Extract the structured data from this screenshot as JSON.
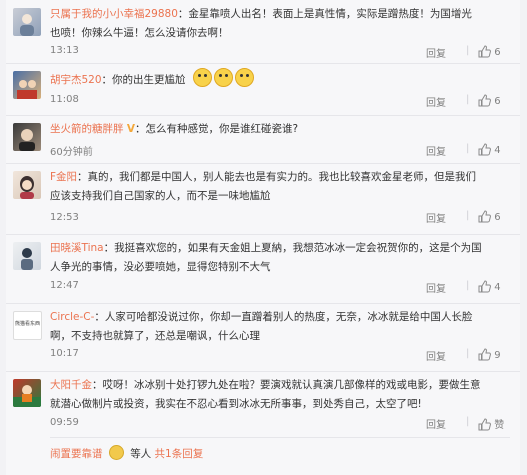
{
  "comments": [
    {
      "username": "只属于我的小小幸福29880",
      "text": "：金星靠喷人出名！表面上是真性情，实际是蹭热度！为国增光也喷！你辣么牛逼！怎么没请你去啊！",
      "time": "13:13",
      "reply_label": "回复",
      "likes": "6",
      "avatar_colors": [
        "#c9cdd6",
        "#8fa0b8"
      ]
    },
    {
      "username": "胡宇杰520",
      "text": "：你的出生更尴尬",
      "emojis": [
        "awkward-emoji-icon",
        "awkward-emoji-icon",
        "awkward-emoji-icon"
      ],
      "time": "11:08",
      "reply_label": "回复",
      "likes": "6",
      "avatar_colors": [
        "#4a6fa5",
        "#d9b07a"
      ]
    },
    {
      "username": "坐火箭的糖胖胖",
      "verified": "V",
      "text": "：怎么有种感觉，你是谁红碰瓷谁?",
      "time": "60分钟前",
      "reply_label": "回复",
      "likes": "4",
      "avatar_colors": [
        "#3a3a3a",
        "#9c8b7a"
      ]
    },
    {
      "username": "F金阳",
      "text": "：真的，我们都是中国人，别人能去也是有实力的。我也比较喜欢金星老师，但是我们应该支持我们自己国家的人，而不是一味地尴尬",
      "time": "12:53",
      "reply_label": "回复",
      "likes": "6",
      "avatar_colors": [
        "#f1e6dc",
        "#3b2f2f"
      ]
    },
    {
      "username": "田晓溪Tina",
      "text": "：我挺喜欢您的，如果有天金姐上夏納，我想范冰冰一定会祝贺你的，这是个为国人争光的事情，没必要喷她，显得您特别不大气",
      "time": "12:47",
      "reply_label": "回复",
      "likes": "4",
      "avatar_colors": [
        "#eef0f2",
        "#2d3a4a"
      ]
    },
    {
      "username": "Circle-C-",
      "text": "：人家可哈都没说过你，你却一直蹭着别人的热度，无奈，冰冰就是给中国人长脸啊，不支持也就算了，还总是嘲讽，什么心理",
      "time": "10:17",
      "reply_label": "回复",
      "likes": "9",
      "avatar_colors": [
        "#ffffff",
        "#444444"
      ],
      "avatar_text": "熊猫看东西"
    },
    {
      "username": "大阳千金",
      "text": "：哎呀！冰冰别十处打锣九处在啦？要演戏就认真演几部像样的戏或电影，要做生意就潜心做制片或投资，我实在不忍心看到冰冰无所事事，到处秀自己，太空了吧!",
      "time": "09:59",
      "reply_label": "回复",
      "likes": "赞",
      "avatar_colors": [
        "#c0392b",
        "#2c7a3f"
      ]
    }
  ],
  "footer": {
    "username": "闹置要靠谱",
    "middle": "等人",
    "more": "共1条回复"
  },
  "colors": {
    "username": "#eb7350",
    "text": "#333333",
    "meta": "#808080"
  }
}
